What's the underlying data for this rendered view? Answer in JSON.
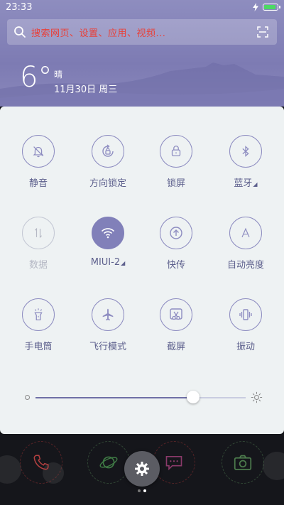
{
  "status": {
    "time": "23:33"
  },
  "search": {
    "placeholder": "搜索网页、设置、应用、视频..."
  },
  "weather": {
    "temperature": "6°",
    "condition": "晴",
    "date": "11月30日 周三"
  },
  "toggles": [
    {
      "label": "静音",
      "icon": "bell-off-icon",
      "state": "off"
    },
    {
      "label": "方向锁定",
      "icon": "rotation-lock-icon",
      "state": "off"
    },
    {
      "label": "锁屏",
      "icon": "lock-icon",
      "state": "off"
    },
    {
      "label": "蓝牙",
      "icon": "bluetooth-icon",
      "state": "off",
      "has_caret": true
    },
    {
      "label": "数据",
      "icon": "mobile-data-icon",
      "state": "disabled"
    },
    {
      "label": "MIUI-2",
      "icon": "wifi-icon",
      "state": "on",
      "has_caret": true
    },
    {
      "label": "快传",
      "icon": "quick-transfer-icon",
      "state": "off"
    },
    {
      "label": "自动亮度",
      "icon": "auto-brightness-icon",
      "state": "off"
    },
    {
      "label": "手电筒",
      "icon": "flashlight-icon",
      "state": "off"
    },
    {
      "label": "飞行模式",
      "icon": "airplane-icon",
      "state": "off"
    },
    {
      "label": "截屏",
      "icon": "screenshot-icon",
      "state": "off"
    },
    {
      "label": "振动",
      "icon": "vibrate-icon",
      "state": "off"
    }
  ],
  "brightness": {
    "level": 0.75
  },
  "colors": {
    "accent": "#8180b9",
    "label": "#5c5f8c",
    "search_text": "#e8413a",
    "battery": "#4cd964"
  },
  "pager": {
    "pages": 2,
    "current": 2
  }
}
